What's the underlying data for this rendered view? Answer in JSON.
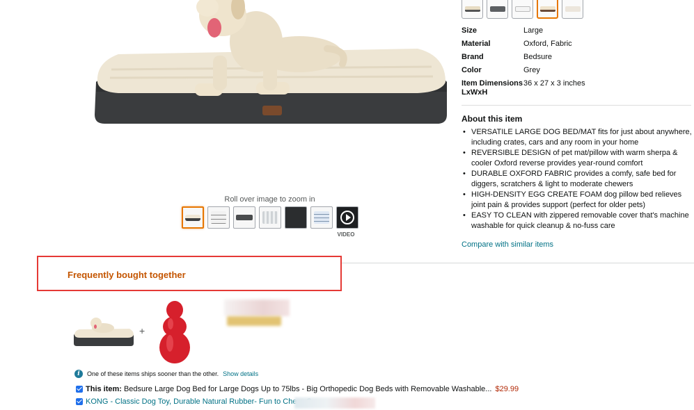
{
  "gallery": {
    "zoom_hint": "Roll over image to zoom in",
    "video_label": "VIDEO",
    "thumbnails": [
      "mat-front",
      "mat-grey",
      "mat-dark",
      "mat-layers",
      "mat-black",
      "mat-diagram",
      "video"
    ]
  },
  "variant_swatches": [
    "beige-1",
    "grey",
    "white",
    "beige-selected",
    "light"
  ],
  "specs": [
    {
      "key": "Size",
      "value": "Large"
    },
    {
      "key": "Material",
      "value": "Oxford, Fabric"
    },
    {
      "key": "Brand",
      "value": "Bedsure"
    },
    {
      "key": "Color",
      "value": "Grey"
    },
    {
      "key": "Item Dimensions LxWxH",
      "value": "36 x 27 x 3 inches"
    }
  ],
  "about": {
    "title": "About this item",
    "bullets": [
      "VERSATILE LARGE DOG BED/MAT fits for just about anywhere, including crates, cars and any room in your home",
      "REVERSIBLE DESIGN of pet mat/pillow with warm sherpa & cooler Oxford reverse provides year-round comfort",
      "DURABLE OXFORD FABRIC provides a comfy, safe bed for diggers, scratchers & light to moderate chewers",
      "HIGH-DENSITY EGG CREATE FOAM dog pillow bed relieves joint pain & provides support (perfect for older pets)",
      "EASY TO CLEAN with zippered removable cover that's machine washable for quick cleanup & no-fuss care"
    ],
    "compare_link": "Compare with similar items"
  },
  "fbt": {
    "title": "Frequently bought together",
    "plus": "+",
    "ship_note": "One of these items ships sooner than the other.",
    "show_details": "Show details",
    "item1": {
      "prefix": "This item:",
      "name": "Bedsure Large Dog Bed for Large Dogs Up to 75lbs - Big Orthopedic Dog Beds with Removable Washable...",
      "price": "$29.99"
    },
    "item2": {
      "name": "KONG - Classic Dog Toy, Durable Natural Rubber- Fun to Chew, C"
    }
  },
  "colors": {
    "accent_orange": "#e77600",
    "heading_orange": "#c45500",
    "link_teal": "#007185",
    "price_red": "#b12704",
    "highlight_frame": "#e53935"
  }
}
